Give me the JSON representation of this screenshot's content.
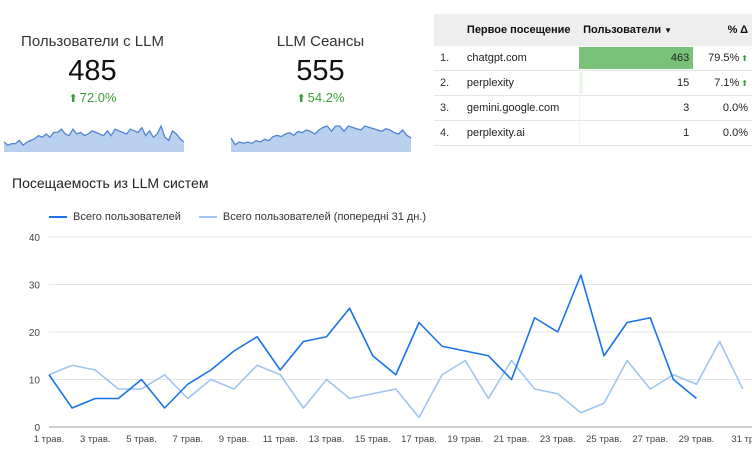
{
  "colors": {
    "primary": "#1a73e8",
    "secondary": "#9fc5f1",
    "spark_fill": "#b9d0ee",
    "spark_line": "#4f86d1",
    "positive": "#3c9c3a",
    "bar_fill": "#79c27a",
    "bar_fill_light": "#eaf6ea"
  },
  "scorecards": [
    {
      "title": "Пользователи с LLM",
      "value": "485",
      "delta": "72.0%",
      "delta_icon": "arrow-up-icon",
      "spark": [
        5,
        3,
        4,
        4,
        6,
        3,
        5,
        6,
        7,
        9,
        8,
        10,
        8,
        11,
        11,
        13,
        10,
        9,
        13,
        10,
        11,
        9,
        10,
        12,
        11,
        10,
        9,
        12,
        9,
        13,
        12,
        11,
        10,
        13,
        12,
        11,
        14,
        9,
        12,
        8,
        10,
        15,
        8,
        6,
        12,
        10,
        7,
        5
      ]
    },
    {
      "title": "LLM Сеансы",
      "value": "555",
      "delta": "54.2%",
      "delta_icon": "arrow-up-icon",
      "spark": [
        9,
        4,
        6,
        5,
        6,
        5,
        7,
        6,
        8,
        7,
        10,
        11,
        10,
        12,
        13,
        11,
        14,
        13,
        15,
        14,
        12,
        15,
        17,
        18,
        14,
        18,
        18,
        14,
        18,
        17,
        16,
        15,
        18,
        17,
        16,
        15,
        14,
        16,
        15,
        13,
        12,
        15,
        11,
        9
      ]
    }
  ],
  "table": {
    "headers": {
      "rank": "",
      "source": "Первое посещение",
      "users": "Пользователи",
      "pct": "% Δ"
    },
    "rows": [
      {
        "rank": "1.",
        "source": "chatgpt.com",
        "users": "463",
        "users_value": 463,
        "pct": "79.5%",
        "up": true
      },
      {
        "rank": "2.",
        "source": "perplexity",
        "users": "15",
        "users_value": 15,
        "pct": "7.1%",
        "up": true
      },
      {
        "rank": "3.",
        "source": "gemini.google.com",
        "users": "3",
        "users_value": 3,
        "pct": "0.0%",
        "up": false
      },
      {
        "rank": "4.",
        "source": "perplexity.ai",
        "users": "1",
        "users_value": 1,
        "pct": "0.0%",
        "up": false
      }
    ]
  },
  "chart_title": "Посещаемость из LLM систем",
  "chart_data": {
    "type": "line",
    "title": "Посещаемость из LLM систем",
    "ylim": [
      0,
      40
    ],
    "yticks": [
      0,
      10,
      20,
      30,
      40
    ],
    "x_tick_labels": [
      "1 трав.",
      "3 трав.",
      "5 трав.",
      "7 трав.",
      "9 трав.",
      "11 трав.",
      "13 трав.",
      "15 трав.",
      "17 трав.",
      "19 трав.",
      "21 трав.",
      "23 трав.",
      "25 трав.",
      "27 трав.",
      "29 трав.",
      "31 тр"
    ],
    "x": [
      1,
      2,
      3,
      4,
      5,
      6,
      7,
      8,
      9,
      10,
      11,
      12,
      13,
      14,
      15,
      16,
      17,
      18,
      19,
      20,
      21,
      22,
      23,
      24,
      25,
      26,
      27,
      28,
      29,
      30,
      31
    ],
    "xlim": [
      1,
      31
    ],
    "legend_position": "top-left",
    "grid": true,
    "series": [
      {
        "name": "Всего пользователей",
        "color": "#1a73e8",
        "values": [
          11,
          4,
          6,
          6,
          10,
          4,
          9,
          12,
          16,
          19,
          12,
          18,
          19,
          25,
          15,
          11,
          22,
          17,
          16,
          15,
          10,
          23,
          20,
          32,
          15,
          22,
          23,
          10,
          6,
          null,
          null
        ]
      },
      {
        "name": "Всего пользователей (попередні 31 дн.)",
        "color": "#9fc5f1",
        "values": [
          11,
          13,
          12,
          8,
          8,
          11,
          6,
          10,
          8,
          13,
          11,
          4,
          10,
          6,
          7,
          8,
          2,
          11,
          14,
          6,
          14,
          8,
          7,
          3,
          5,
          14,
          8,
          11,
          9,
          18,
          8
        ]
      }
    ]
  }
}
